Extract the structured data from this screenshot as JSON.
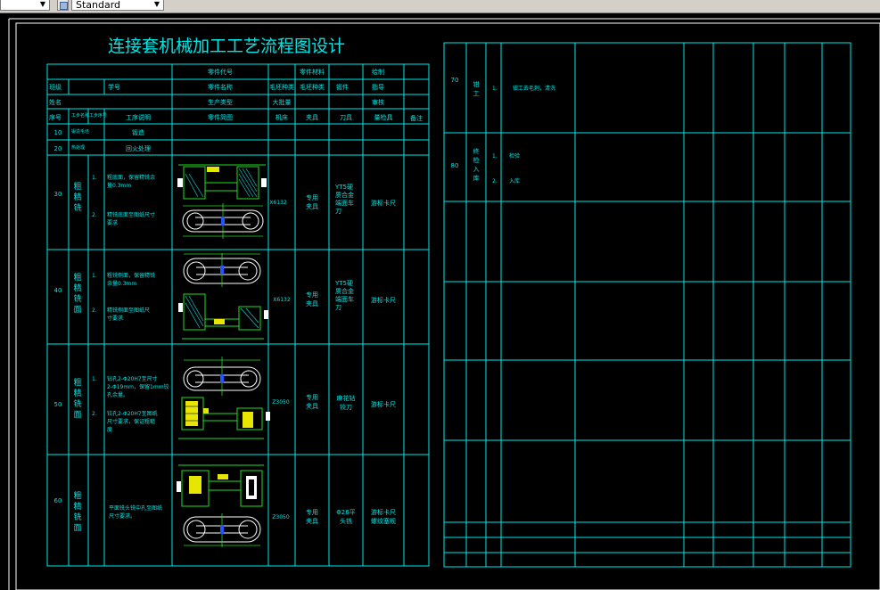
{
  "toolbar": {
    "layer_combo": "",
    "style_combo": "Standard"
  },
  "title": "连接套机械加工工艺流程图设计",
  "header": {
    "part_code": "零件代号",
    "part_material": "零件材料",
    "drawn_by": "绘制",
    "class": "班级",
    "student_no": "学号",
    "part_name": "零件名称",
    "blank_type": "毛坯种类",
    "blank_type_val": "毛坯种类",
    "forging": "锻件",
    "instructor": "指导",
    "name": "姓名",
    "production_type": "生产类型",
    "mass_prod": "大批量",
    "reviewer": "审核"
  },
  "col_headers": {
    "seq": "序号",
    "step_name": "工步名称",
    "sub_step": "工步序号",
    "desc": "工序说明",
    "sketch": "零件简图",
    "machine": "机床",
    "fixture": "夹具",
    "tool": "刀具",
    "gauge": "量检具",
    "remark": "备注"
  },
  "rows": [
    {
      "seq": "10",
      "name": "锻造毛坯",
      "desc": "锻造"
    },
    {
      "seq": "20",
      "name": "热处理",
      "desc": "回火处理"
    },
    {
      "seq": "30",
      "name": "粗精铣",
      "steps": [
        "1.",
        "2."
      ],
      "texts": [
        "粗底面，保留精铣余量0.3mm",
        "精铣底面至图纸尺寸要求"
      ],
      "machine": "X6132",
      "fixture": "专用夹具",
      "tool": "YT5硬质合金端面车刀",
      "gauge": "游标卡尺"
    },
    {
      "seq": "40",
      "name": "粗精铣面",
      "steps": [
        "1.",
        "2."
      ],
      "texts": [
        "粗铣侧面，保留精铣余量0.3mm",
        "精铣侧面至图纸尺寸要求"
      ],
      "machine": "X6132",
      "fixture": "专用夹具",
      "tool": "YT5硬质合金端面车刀",
      "gauge": "游标卡尺"
    },
    {
      "seq": "50",
      "name": "粗精铣面",
      "steps": [
        "1.",
        "2."
      ],
      "texts": [
        "钻孔2-Φ20H7至尺寸2-Φ19mm，保留1mm铰孔余量",
        "铰孔2-Φ20H7至图纸尺寸要求，保证粗糙度"
      ],
      "machine": "Z3050",
      "fixture": "专用夹具",
      "tool": "麻花钻铰刀",
      "gauge": "游标卡尺"
    },
    {
      "seq": "60",
      "name": "粗精铣面",
      "steps": [
        ""
      ],
      "texts": [
        "平面铣头铣中孔至图纸尺寸要求"
      ],
      "machine": "Z3050",
      "fixture": "专用夹具",
      "tool": "Φ26平头铣",
      "gauge": "游标卡尺螺纹塞规"
    }
  ],
  "right_rows": [
    {
      "seq": "70",
      "name": "钳工",
      "steps": [
        "1."
      ],
      "texts": [
        "钳工去毛刺，清洗"
      ]
    },
    {
      "seq": "80",
      "name": "终检入库",
      "steps": [
        "1.",
        "2."
      ],
      "texts": [
        "检验",
        "入库"
      ]
    }
  ],
  "colors": {
    "line": "#00e6e6",
    "bg": "#000000",
    "text": "#00e6e6",
    "white": "#ffffff",
    "green": "#22dd22",
    "yellow": "#e6e600"
  }
}
